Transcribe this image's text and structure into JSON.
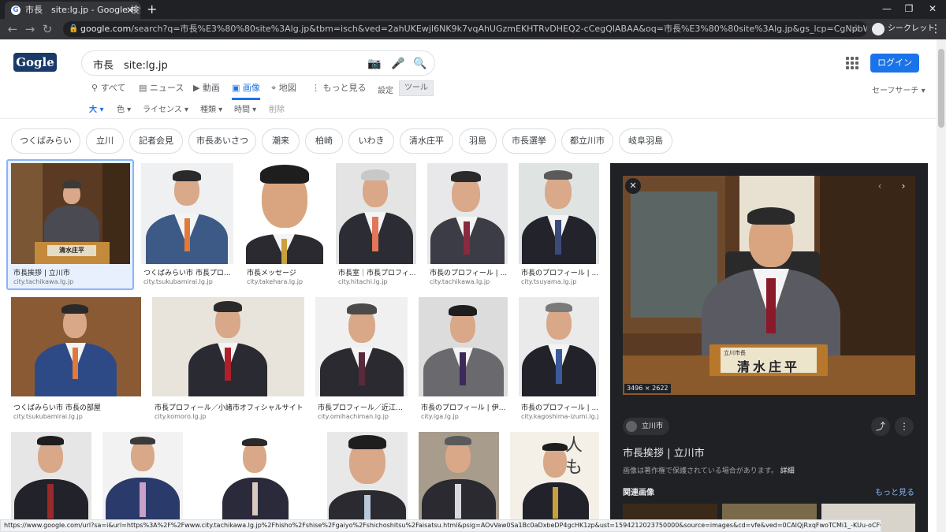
{
  "browser": {
    "tab_title": "市長　site:lg.jp - Google 検索",
    "url_domain": "google.com",
    "url_rest": "/search?q=市長%E3%80%80site%3Alg.jp&tbm=isch&ved=2ahUKEwjI6NK9k7vqAhUGzmEKHTRvDHEQ2-cCegQIABAA&oq=市長%E3%80%80site%3Alg.jp&gs_lcp=CgNpbWcQA1CMrgdY9OUHYKXqB2gLcAB4AIA...",
    "incognito_label": "シークレット",
    "status_url": "https://www.google.com/url?sa=i&url=https%3A%2F%2Fwww.city.tachikawa.lg.jp%2Fhisho%2Fshise%2Fgaiyo%2Fshichoshitsu%2Faisatsu.html&psig=AOvVaw0Sa1Bc0aDxbeDP4gcHK1zp&ust=1594212023750000&source=images&cd=vfe&ved=0CAIQjRxqFwoTCMi1_-KUu-oCFQAAAAAdAAAAABAD"
  },
  "header": {
    "search_value": "市長　site:lg.jp",
    "login_label": "ログイン"
  },
  "nav": {
    "tabs": [
      "すべて",
      "ニュース",
      "動画",
      "画像",
      "地図",
      "もっと見る"
    ],
    "settings": "設定",
    "tools": "ツール",
    "safesearch": "セーフサーチ ▾"
  },
  "filters": [
    "大 ▾",
    "色 ▾",
    "ライセンス ▾",
    "種類 ▾",
    "時間 ▾",
    "削除"
  ],
  "chips": [
    "つくばみらい",
    "立川",
    "記者会見",
    "市長あいさつ",
    "潮来",
    "柏崎",
    "いわき",
    "清水庄平",
    "羽島",
    "市長選挙",
    "都立川市",
    "岐阜羽島"
  ],
  "results": [
    {
      "caption": "市長挨拶 | 立川市",
      "domain": "city.tachikawa.lg.jp"
    },
    {
      "caption": "つくばみらい市 市長プロフ...",
      "domain": "city.tsukubamirai.lg.jp"
    },
    {
      "caption": "市長メッセージ",
      "domain": "city.takehara.lg.jp"
    },
    {
      "caption": "市長室｜市長プロフィ...",
      "domain": "city.hitachi.lg.jp"
    },
    {
      "caption": "市長のプロフィール | ...",
      "domain": "city.tachikawa.lg.jp"
    },
    {
      "caption": "市長のプロフィール | ...",
      "domain": "city.tsuyama.lg.jp"
    },
    {
      "caption": "つくばみらい市 市長の部屋",
      "domain": "city.tsukubamirai.lg.jp"
    },
    {
      "caption": "市長プロフィール／小諸市オフィシャルサイト",
      "domain": "city.komoro.lg.jp"
    },
    {
      "caption": "市長プロフィール／近江八...",
      "domain": "city.omihachiman.lg.jp"
    },
    {
      "caption": "市長のプロフィール | 伊賀...",
      "domain": "city.iga.lg.jp"
    },
    {
      "caption": "市長のプロフィール | ...",
      "domain": "city.kagoshima-izumi.lg.jp"
    }
  ],
  "nameplate": {
    "title": "立川市長",
    "name": "清水庄平"
  },
  "panel": {
    "dims": "3496 × 2622",
    "site": "立川市",
    "title": "市長挨拶 | 立川市",
    "copyright": "画像は著作権で保護されている場合があります。",
    "details": "詳細",
    "related": "関連画像",
    "more": "もっと見る"
  }
}
